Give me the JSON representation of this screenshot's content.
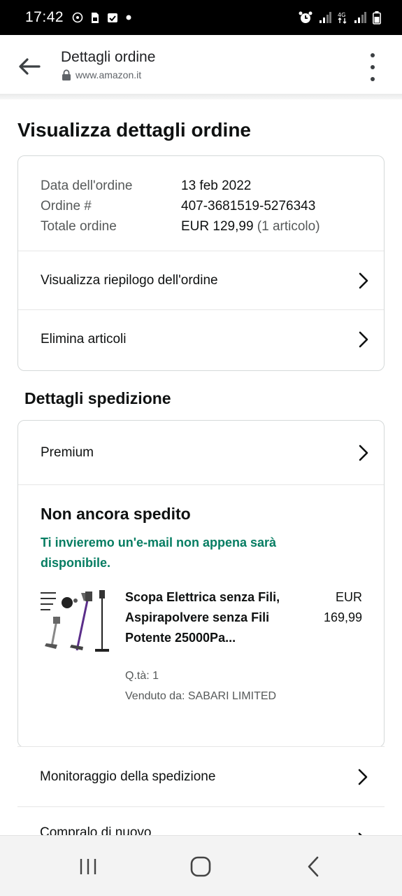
{
  "status_bar": {
    "time": "17:42"
  },
  "header": {
    "title": "Dettagli ordine",
    "url": "www.amazon.it"
  },
  "page_title": "Visualizza dettagli ordine",
  "order": {
    "date_label": "Data dell'ordine",
    "date_value": "13 feb 2022",
    "number_label": "Ordine #",
    "number_value": "407-3681519-5276343",
    "total_label": "Totale ordine",
    "total_value": "EUR 129,99",
    "total_items": "(1 articolo)",
    "summary_link": "Visualizza riepilogo dell'ordine",
    "delete_link": "Elimina articoli"
  },
  "shipping": {
    "section_title": "Dettagli spedizione",
    "method": "Premium",
    "status": "Non ancora spedito",
    "note": "Ti invieremo un'e-mail non appena sarà disponibile.",
    "product": {
      "title": "Scopa Elettrica senza Fili, Aspirapolvere senza Fili Potente 25000Pa...",
      "currency": "EUR",
      "price": "169,99",
      "qty": "Q.tà: 1",
      "seller": "Venduto da: SABARI LIMITED"
    }
  },
  "actions": {
    "tracking": "Monitoraggio della spedizione",
    "buy_again": "Compralo di nuovo"
  },
  "colors": {
    "accent_green": "#067d62",
    "text": "#0f1111",
    "muted": "#565959",
    "border": "#d5d9d9"
  },
  "icons": [
    "back-arrow-icon",
    "lock-icon",
    "kebab-menu-icon",
    "chevron-right-icon",
    "recent-apps-icon",
    "home-icon",
    "back-nav-icon"
  ]
}
